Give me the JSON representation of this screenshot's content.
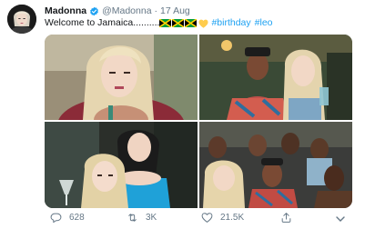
{
  "tweet": {
    "author_name": "Madonna",
    "handle": "@Madonna",
    "separator": "·",
    "date": "17 Aug",
    "text": "Welcome to Jamaica..........",
    "hashtags": [
      "#birthday",
      "#leo"
    ],
    "emoji": [
      "jamaica-flag",
      "jamaica-flag",
      "jamaica-flag",
      "yellow-heart"
    ]
  },
  "actions": {
    "reply_count": "628",
    "retweet_count": "3K",
    "like_count": "21.5K"
  },
  "colors": {
    "link": "#1da1f2",
    "secondary_text": "#657786",
    "verified": "#1da1f2",
    "heart": "#ffcc4d"
  }
}
